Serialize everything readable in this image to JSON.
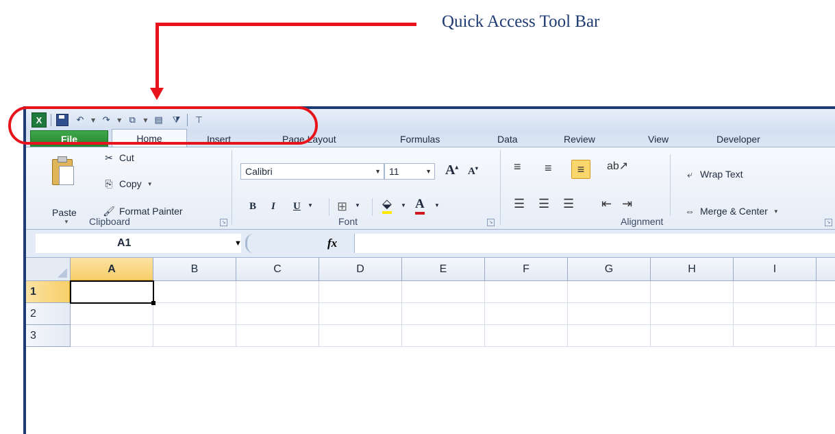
{
  "annotation": {
    "text": "Quick Access Tool Bar",
    "color": "#e8141b"
  },
  "quick_access": {
    "icons": [
      "excel-logo-icon",
      "save-icon",
      "undo-icon",
      "redo-icon",
      "copy-paste-icon",
      "form-icon",
      "filter-icon",
      "customize-icon"
    ]
  },
  "tabs": [
    "File",
    "Home",
    "Insert",
    "Page Layout",
    "Formulas",
    "Data",
    "Review",
    "View",
    "Developer"
  ],
  "ribbon": {
    "clipboard": {
      "paste": "Paste",
      "cut": "Cut",
      "copy": "Copy",
      "format_painter": "Format Painter",
      "label": "Clipboard"
    },
    "font": {
      "name": "Calibri",
      "size": "11",
      "bold": "B",
      "italic": "I",
      "underline": "U",
      "label": "Font"
    },
    "alignment": {
      "wrap_text": "Wrap Text",
      "merge_center": "Merge & Center",
      "label": "Alignment"
    }
  },
  "formula_bar": {
    "name_box": "A1",
    "fx": "fx",
    "formula": ""
  },
  "sheet": {
    "columns": [
      "A",
      "B",
      "C",
      "D",
      "E",
      "F",
      "G",
      "H",
      "I"
    ],
    "rows": [
      "1",
      "2",
      "3"
    ],
    "active_cell": "A1"
  },
  "colors": {
    "file_tab": "#25812f",
    "selection": "#f8cf6a",
    "window_border": "#1f3b73"
  }
}
